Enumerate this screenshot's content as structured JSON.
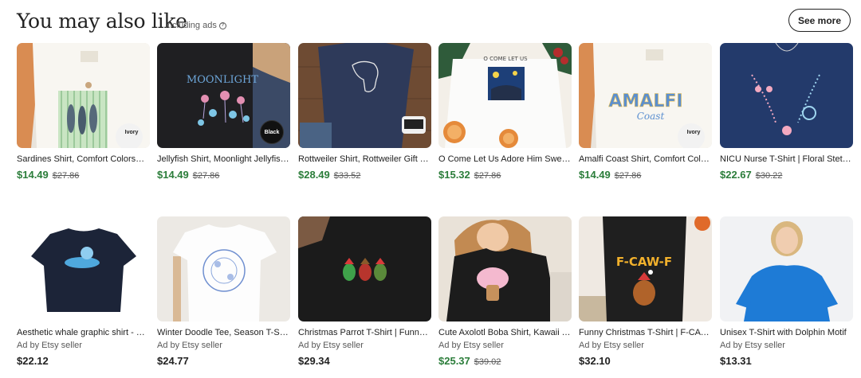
{
  "header": {
    "title": "You may also like",
    "ads_note": "Including ads",
    "info_icon": "info-icon",
    "see_more": "See more"
  },
  "listings": [
    {
      "name": "Sardines Shirt, Comfort Colors® Shirt, Fish Shirt",
      "price": "$14.49",
      "original": "$27.86",
      "on_sale": true,
      "color_tag": "Ivory"
    },
    {
      "name": "Jellyfish Shirt, Moonlight Jellyfish Tee",
      "price": "$14.49",
      "original": "$27.86",
      "on_sale": true,
      "color_tag": "Black"
    },
    {
      "name": "Rottweiler Shirt, Rottweiler Gift Tee",
      "price": "$28.49",
      "original": "$33.52",
      "on_sale": true,
      "color_tag": ""
    },
    {
      "name": "O Come Let Us Adore Him Sweatshirt",
      "price": "$15.32",
      "original": "$27.86",
      "on_sale": true,
      "color_tag": ""
    },
    {
      "name": "Amalfi Coast Shirt, Comfort Colors Tee",
      "price": "$14.49",
      "original": "$27.86",
      "on_sale": true,
      "color_tag": "Ivory"
    },
    {
      "name": "NICU Nurse T-Shirt | Floral Stethoscope",
      "price": "$22.67",
      "original": "$30.22",
      "on_sale": true,
      "color_tag": ""
    },
    {
      "name": "Aesthetic whale graphic shirt - Blue",
      "seller": "Ad by Etsy seller",
      "price": "$22.12",
      "original": "",
      "on_sale": false,
      "color_tag": ""
    },
    {
      "name": "Winter Doodle Tee, Season T-Shirt",
      "seller": "Ad by Etsy seller",
      "price": "$24.77",
      "original": "",
      "on_sale": false,
      "color_tag": ""
    },
    {
      "name": "Christmas Parrot T-Shirt | Funny Gift",
      "seller": "Ad by Etsy seller",
      "price": "$29.34",
      "original": "",
      "on_sale": false,
      "color_tag": ""
    },
    {
      "name": "Cute Axolotl Boba Shirt, Kawaii Tee",
      "seller": "Ad by Etsy seller",
      "price": "$25.37",
      "original": "$39.02",
      "on_sale": true,
      "color_tag": ""
    },
    {
      "name": "Funny Christmas T-Shirt | F-CAW-F Tee",
      "seller": "Ad by Etsy seller",
      "price": "$32.10",
      "original": "",
      "on_sale": false,
      "color_tag": ""
    },
    {
      "name": "Unisex T-Shirt with Dolphin Motif",
      "seller": "Ad by Etsy seller",
      "price": "$13.31",
      "original": "",
      "on_sale": false,
      "color_tag": ""
    }
  ],
  "thumb_text": {
    "moonlight": "MOONLIGHT",
    "come": "O COME LET US",
    "amalfi": "AMALFI",
    "coast": "Coast",
    "fcawf": "F-CAW-F"
  },
  "colors": {
    "sale_price": "#2b7d3a",
    "text": "#222222",
    "muted": "#595959"
  }
}
